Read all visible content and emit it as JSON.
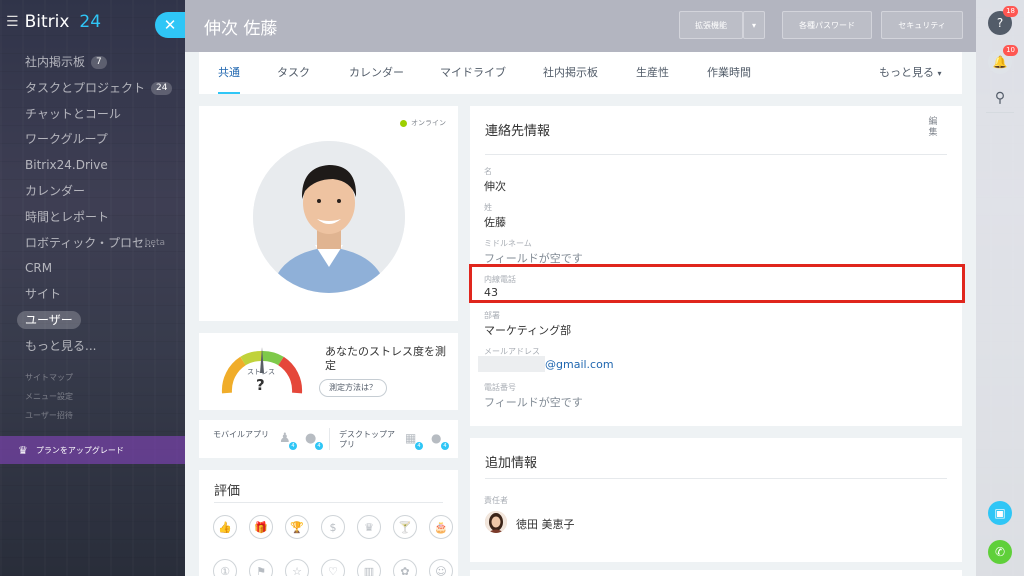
{
  "brand": {
    "name": "Bitrix",
    "num": "24"
  },
  "sidebar": {
    "items": [
      {
        "label": "社内掲示板",
        "count": "7"
      },
      {
        "label": "タスクとプロジェクト",
        "count": "24"
      },
      {
        "label": "チャットとコール"
      },
      {
        "label": "ワークグループ"
      },
      {
        "label": "Bitrix24.Drive"
      },
      {
        "label": "カレンダー"
      },
      {
        "label": "時間とレポート"
      },
      {
        "label": "ロボティック・プロセ...",
        "beta": "beta"
      },
      {
        "label": "CRM"
      },
      {
        "label": "サイト"
      },
      {
        "label": "ユーザー"
      },
      {
        "label": "もっと見る..."
      }
    ],
    "sub_items": [
      "サイトマップ",
      "メニュー設定",
      "ユーザー招待"
    ],
    "upgrade": "プランをアップグレード"
  },
  "header": {
    "title": "伸次 佐藤",
    "extensions": "拡張機能",
    "passwords": "各種パスワード",
    "security": "セキュリティ"
  },
  "tabs": [
    "共通",
    "タスク",
    "カレンダー",
    "マイドライブ",
    "社内掲示板",
    "生産性",
    "作業時間"
  ],
  "tabs_more": "もっと見る",
  "profile": {
    "status": "オンライン"
  },
  "stress": {
    "gauge_label": "ストレス",
    "gauge_value": "?",
    "title": "あなたのストレス度を測定",
    "button": "測定方法は？"
  },
  "apps": {
    "mobile": "モバイルアプリ",
    "desktop": "デスクトップアプリ",
    "badges": [
      "4",
      "4",
      "4",
      "4"
    ]
  },
  "rating": {
    "title": "評価"
  },
  "contact": {
    "title": "連絡先情報",
    "edit": "編集",
    "fields": [
      {
        "label": "名",
        "value": "伸次"
      },
      {
        "label": "姓",
        "value": "佐藤"
      },
      {
        "label": "ミドルネーム",
        "value": "フィールドが空です"
      },
      {
        "label": "内線電話",
        "value": "43"
      },
      {
        "label": "部署",
        "value": "マーケティング部"
      },
      {
        "label": "メールアドレス",
        "value": "@gmail.com"
      },
      {
        "label": "電話番号",
        "value": "フィールドが空です"
      }
    ]
  },
  "additional": {
    "title": "追加情報",
    "manager_label": "責任者",
    "manager_name": "徳田 美恵子"
  },
  "rightbar": {
    "help_badge": "18",
    "notify_badge": "10"
  },
  "colors": {
    "accent": "#2fc6f6",
    "highlight": "#e0261d",
    "link": "#2067b0"
  }
}
